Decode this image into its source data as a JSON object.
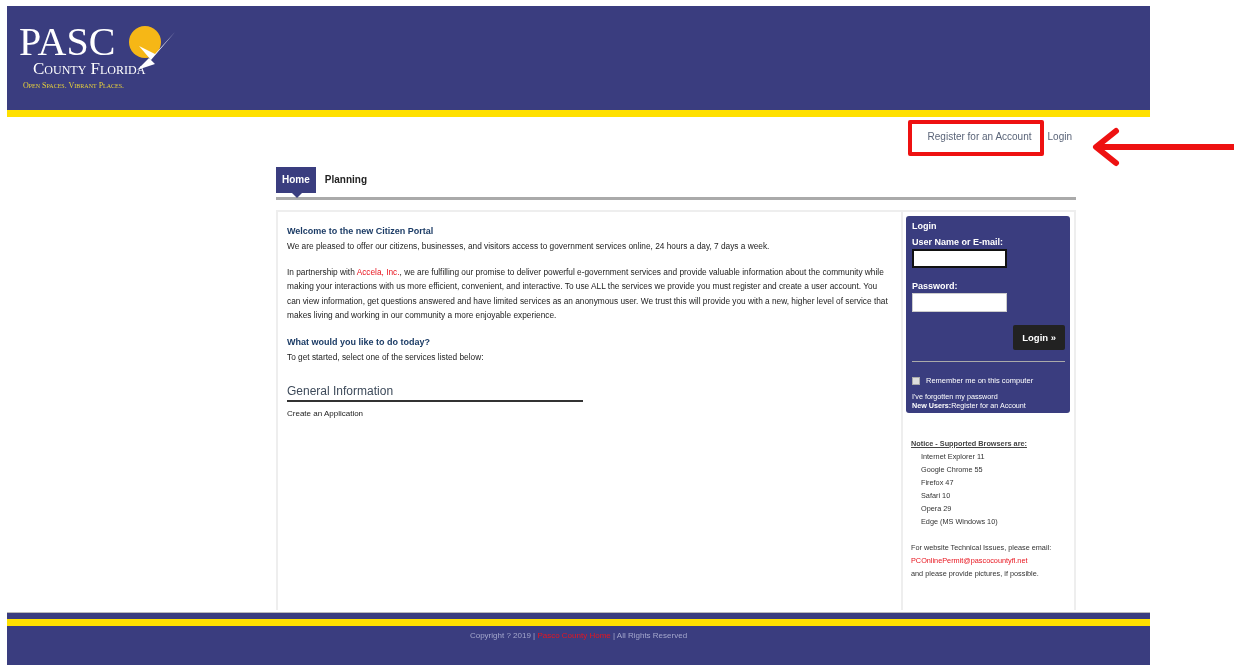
{
  "logo": {
    "name": "PASC",
    "county": "County Florida",
    "tagline": "Open Spaces. Vibrant Places."
  },
  "top_links": [
    {
      "label": "Register for an Account",
      "highlighted": true
    },
    {
      "label": "Login",
      "highlighted": false
    }
  ],
  "tabs": [
    {
      "label": "Home",
      "selected": true
    },
    {
      "label": "Planning",
      "selected": false
    }
  ],
  "welcome": {
    "title": "Welcome to the new Citizen Portal",
    "intro": "We are pleased to offer our citizens, businesses, and visitors access to government services online, 24 hours a day, 7 days a week.",
    "partner_before": "In partnership with ",
    "partner_link": "Accela, Inc.",
    "partner_after": ", we are fulfilling our promise to deliver powerful e-government services and provide valuable information about the community while making your interactions with us more efficient, convenient, and interactive. To use ALL the services we provide you must register and create a user account. You can view information, get questions answered and have limited services as an anonymous user. We trust this will provide you with a new, higher level of service that makes living and working in our community a more enjoyable experience.",
    "question": "What would you like to do today?",
    "hint": "To get started, select one of the services listed below:"
  },
  "general_information": {
    "heading": "General Information",
    "links": [
      "Create an Application"
    ]
  },
  "login": {
    "title": "Login",
    "username_label": "User Name or E-mail:",
    "password_label": "Password:",
    "button": "Login »",
    "remember": {
      "label": "Remember me on this computer",
      "checked": false
    },
    "forgot": "I've forgotten my password",
    "new_users_label": "New Users:",
    "register_link": "Register for an Account"
  },
  "notice": {
    "title": "Notice - Supported Browsers are:",
    "browsers": [
      "Internet Explorer 11",
      "Google Chrome 55",
      "Firefox 47",
      "Safari 10",
      "Opera 29",
      "Edge (MS Windows 10)"
    ],
    "contact_text": "For website Technical Issues, please email:",
    "email": "PCOnlinePermit@pascocountyfl.net",
    "closing": "and please provide pictures, if possible."
  },
  "footer": {
    "copyright": "Copyright ? 2019 |",
    "home_link": "Pasco County Home",
    "rights": "| All Rights Reserved"
  }
}
